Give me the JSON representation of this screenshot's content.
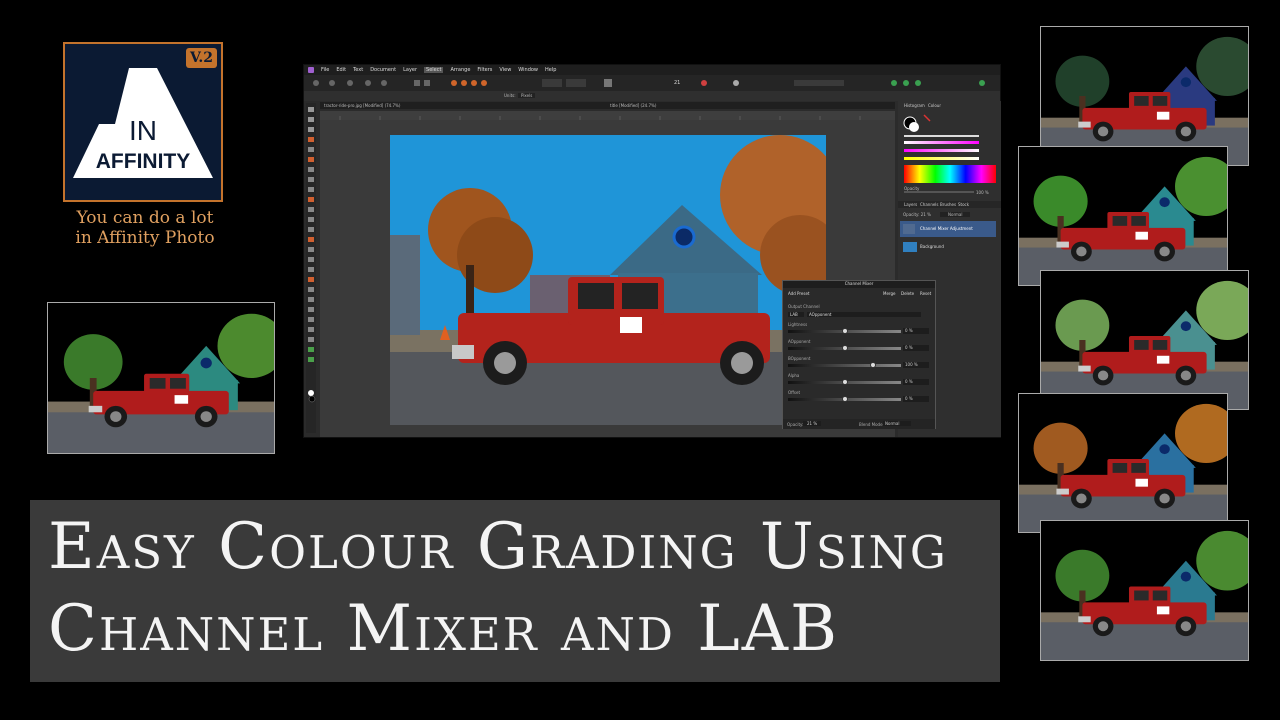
{
  "logo": {
    "version_badge": "V.2",
    "line1": "IN",
    "line2": "AFFINITY"
  },
  "tagline": {
    "line1": "You can do a lot",
    "line2": "in Affinity Photo"
  },
  "title": {
    "line1": "Easy Colour Grading Using",
    "line2": "Channel Mixer and LAB"
  },
  "app": {
    "menu": [
      "File",
      "Edit",
      "Text",
      "Document",
      "Layer",
      "Select",
      "Arrange",
      "Filters",
      "View",
      "Window",
      "Help"
    ],
    "selected_menu": "Select",
    "zoom_value": "21",
    "context": {
      "units_label": "Units:",
      "units_value": "Pixels"
    },
    "document_tab": "tractor-ride-pro.jpg [Modified] (74.7%)",
    "second_tab": "title [Modified] (24.7%)",
    "panel_tabs": [
      "Histogram",
      "Colour"
    ],
    "opacity_label": "Opacity",
    "opacity_value": "100 %",
    "layer_tabs": [
      "Layers",
      "Channels",
      "Brushes",
      "Stock"
    ],
    "layer_opacity": "Opacity: 21 %",
    "blend_mode": "Normal",
    "layers": [
      {
        "name": "Channel Mixer Adjustment"
      },
      {
        "name": "Background"
      }
    ]
  },
  "mixer": {
    "title": "Channel Mixer",
    "add_preset": "Add Preset",
    "buttons": [
      "Merge",
      "Delete",
      "Reset"
    ],
    "output_channel_label": "Output Channel",
    "colour_space": "LAB",
    "channel": "AOpponent",
    "sliders": [
      {
        "label": "Lightness",
        "value": "0 %",
        "fraction": 0.5
      },
      {
        "label": "AOpponent",
        "value": "0 %",
        "fraction": 0.5
      },
      {
        "label": "BOpponent",
        "value": "100 %",
        "fraction": 0.75
      },
      {
        "label": "Alpha",
        "value": "0 %",
        "fraction": 0.5
      },
      {
        "label": "Offset",
        "value": "0 %",
        "fraction": 0.5
      }
    ],
    "opacity_label": "Opacity:",
    "opacity_value": "21 %",
    "blend_label": "Blend Mode:",
    "blend_value": "Normal"
  },
  "colors": {
    "accent": "#c4732c",
    "truck": "#b02020",
    "banner_bg": "#3a3a3a"
  }
}
